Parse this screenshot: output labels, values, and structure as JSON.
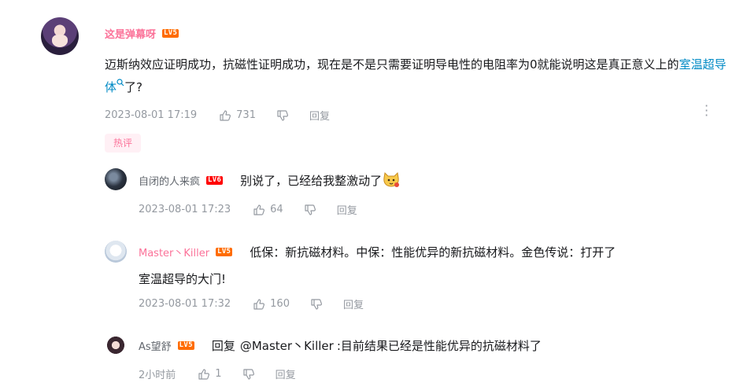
{
  "main": {
    "username": "这是弹幕呀",
    "level": "LV5",
    "text_before": "迈斯纳效应证明成功，抗磁性证明成功，现在是不是只需要证明导电性的电阻率为0就能说明这是真正意义上的",
    "link": "室温超导体",
    "text_after": "了?",
    "time": "2023-08-01 17:19",
    "likes": "731",
    "reply_label": "回复",
    "hot_badge": "热评"
  },
  "replies": [
    {
      "username": "自闭的人来疯",
      "level": "LV6",
      "text": "别说了，已经给我整激动了",
      "time": "2023-08-01 17:23",
      "likes": "64",
      "reply_label": "回复"
    },
    {
      "username": "Master丶Killer",
      "level": "LV5",
      "text_line1": "低保：新抗磁材料。中保：性能优异的新抗磁材料。金色传说：打开了",
      "text_line2": "室温超导的大门!",
      "time": "2023-08-01 17:32",
      "likes": "160",
      "reply_label": "回复"
    },
    {
      "username": "As望舒",
      "level": "LV5",
      "reply_prefix": "回复",
      "mention": "@Master丶Killer",
      "text": ":目前结果已经是性能优异的抗磁材料了",
      "time": "2小时前",
      "likes": "1",
      "reply_label": "回复"
    }
  ],
  "colors": {
    "accent": "#fb7299",
    "link": "#008ac5",
    "meta": "#9499a0"
  }
}
